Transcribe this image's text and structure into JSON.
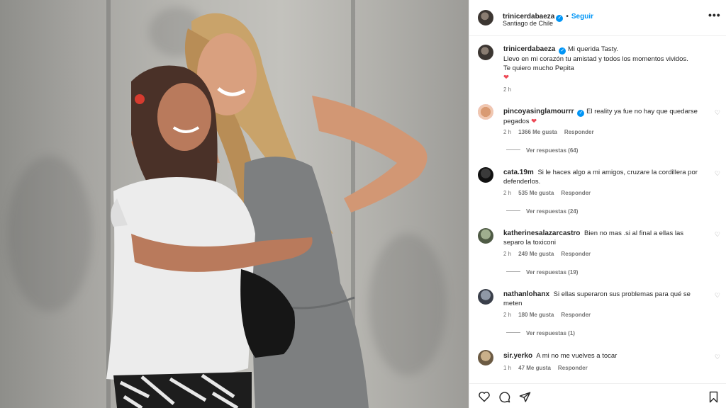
{
  "post": {
    "author": "trinicerdabaeza",
    "follow_label": "Seguir",
    "location": "Santiago de Chile",
    "caption_lines": [
      "Mi querida Tasty.",
      "Llevo en mi corazón tu amistad y todos los momentos vividos.",
      "Te quiero mucho Pepita"
    ],
    "caption_time": "2 h"
  },
  "comments": [
    {
      "user": "pincoyasinglamourrr",
      "verified": true,
      "text": "El reality ya fue no hay que quedarse pegados",
      "time": "2 h",
      "likes": "1366 Me gusta",
      "reply": "Responder",
      "replies": "Ver respuestas (64)"
    },
    {
      "user": "cata.19m",
      "verified": false,
      "text": "Si le haces algo a mi amigos, cruzare la cordillera por defenderlos.",
      "time": "2 h",
      "likes": "535 Me gusta",
      "reply": "Responder",
      "replies": "Ver respuestas (24)"
    },
    {
      "user": "katherinesalazarcastro",
      "verified": false,
      "text": "Bien no mas .si al final a ellas las separo la toxiconi",
      "time": "2 h",
      "likes": "249 Me gusta",
      "reply": "Responder",
      "replies": "Ver respuestas (19)"
    },
    {
      "user": "nathanlohanx",
      "verified": false,
      "text": "Si ellas superaron sus problemas para qué se meten",
      "time": "2 h",
      "likes": "180 Me gusta",
      "reply": "Responder",
      "replies": "Ver respuestas (1)"
    },
    {
      "user": "sir.yerko",
      "verified": false,
      "text": "A mi no me vuelves a tocar",
      "time": "1 h",
      "likes": "47 Me gusta",
      "reply": "Responder",
      "replies": ""
    }
  ],
  "icons": {
    "verified": "verified-badge-icon",
    "like": "heart-outline-icon",
    "comment": "comment-bubble-icon",
    "share": "paper-plane-icon",
    "save": "bookmark-icon",
    "more": "more-options-icon"
  },
  "colors": {
    "accent": "#0095f6",
    "heart": "#ed4956",
    "muted": "#737373"
  }
}
